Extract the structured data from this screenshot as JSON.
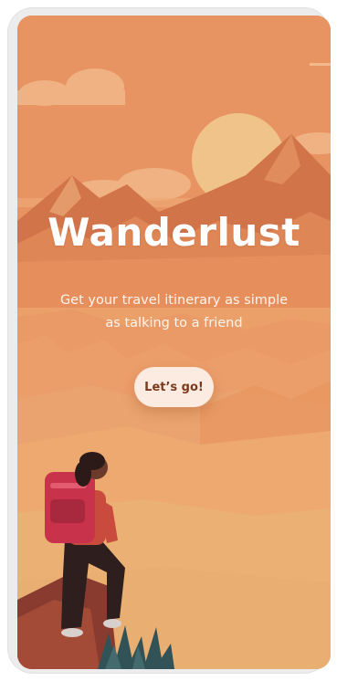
{
  "app": {
    "title": "Wanderlust",
    "tagline": "Get your travel itinerary as simple as talking to a friend"
  },
  "actions": {
    "start_label": "Let’s go!"
  },
  "theme": {
    "background": "#eaa36e",
    "accent": "#c8324a",
    "button_bg": "#fbebe0",
    "button_text": "#7a3a1e",
    "title_color": "#ffffff"
  },
  "icons": [
    "hiker-illustration",
    "sun-icon",
    "cloud-icon",
    "mountain-illustration"
  ]
}
